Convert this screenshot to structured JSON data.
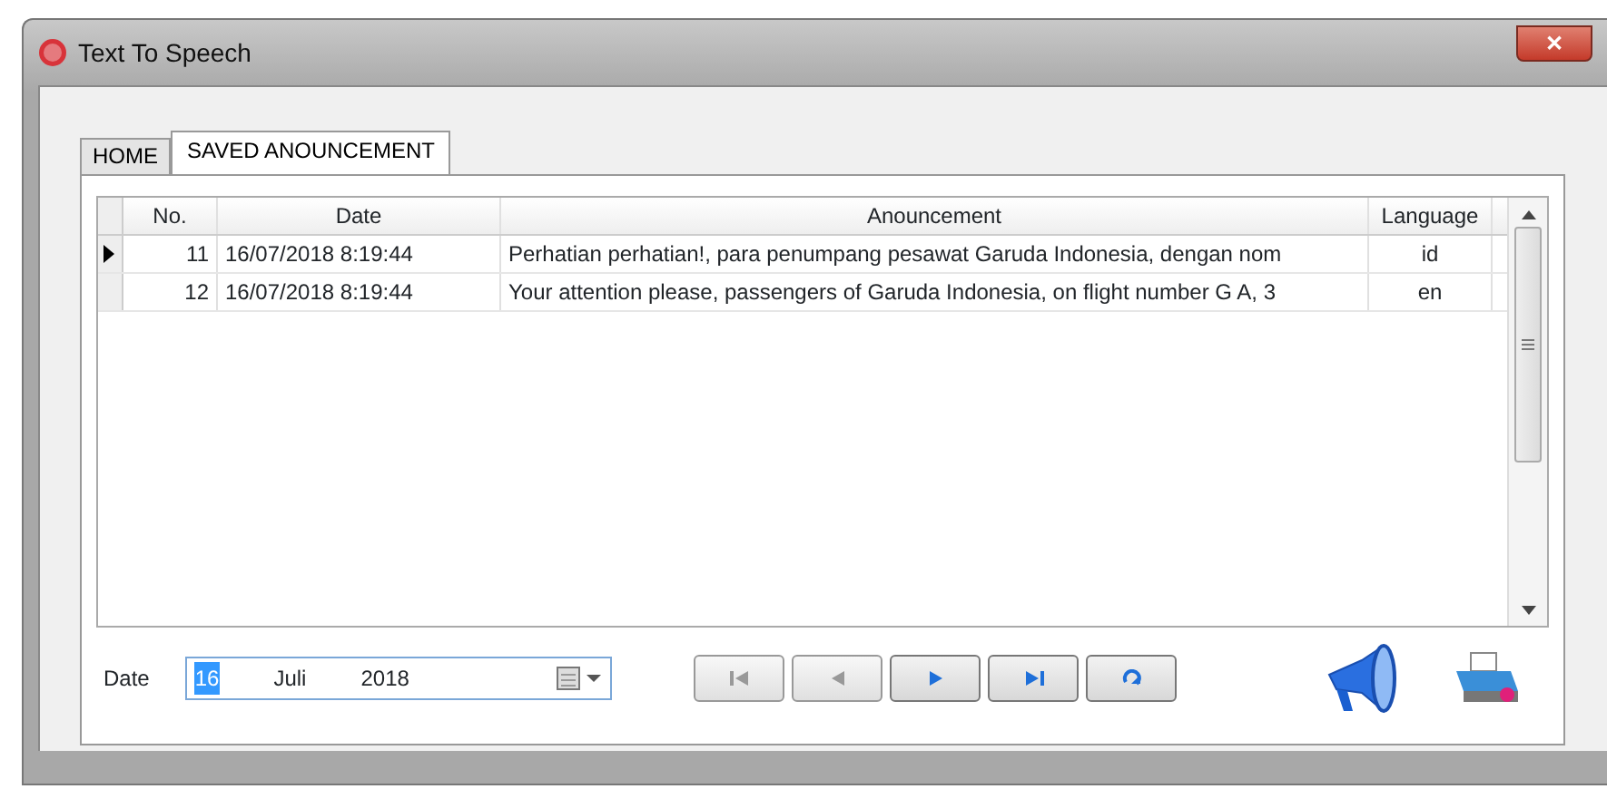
{
  "window": {
    "title": "Text To Speech",
    "close": "✕"
  },
  "tabs": [
    {
      "label": "HOME",
      "selected": false
    },
    {
      "label": "SAVED ANOUNCEMENT",
      "selected": true
    }
  ],
  "table": {
    "columns": [
      "No.",
      "Date",
      "Anouncement",
      "Language"
    ],
    "rows": [
      {
        "no": "11",
        "date": "16/07/2018 8:19:44",
        "text": "Perhatian perhatian!, para penumpang pesawat Garuda Indonesia, dengan nom",
        "language": "id",
        "selected": true
      },
      {
        "no": "12",
        "date": "16/07/2018 8:19:44",
        "text": "Your attention please, passengers of Garuda Indonesia, on flight number G A, 3",
        "language": "en",
        "selected": false
      }
    ]
  },
  "date_filter": {
    "label": "Date",
    "day": "16",
    "month": "Juli",
    "year": "2018"
  },
  "navigator": [
    {
      "kind": "first",
      "disabled": true
    },
    {
      "kind": "prev",
      "disabled": true
    },
    {
      "kind": "next",
      "disabled": false
    },
    {
      "kind": "last",
      "disabled": false
    },
    {
      "kind": "refresh",
      "disabled": false
    }
  ]
}
